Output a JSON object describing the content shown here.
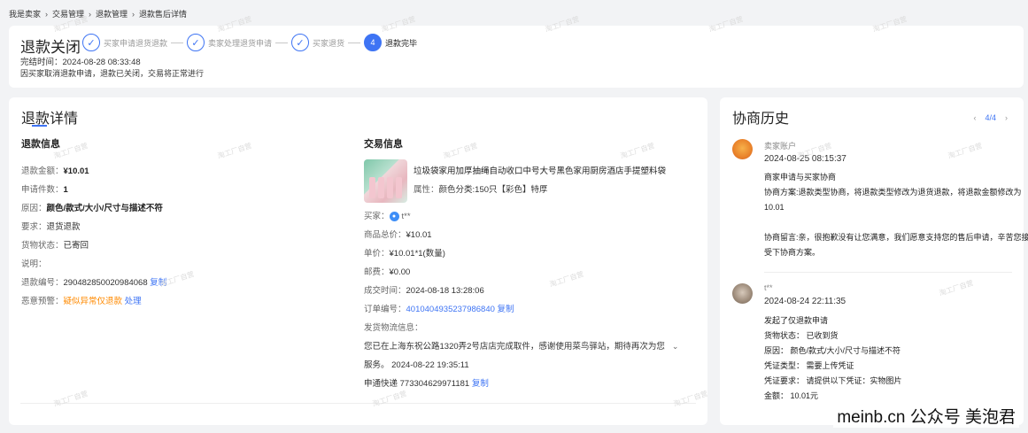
{
  "breadcrumb": [
    "我是卖家",
    "交易管理",
    "退款管理",
    "退款售后详情"
  ],
  "breadcrumb_sep": "›",
  "status": {
    "title": "退款关闭",
    "steps": [
      {
        "label": "买家申请退货退款",
        "icon": "✓"
      },
      {
        "label": "卖家处理退货申请",
        "icon": "✓"
      },
      {
        "label": "买家退货",
        "icon": "✓"
      },
      {
        "label": "退款完毕",
        "icon": "4"
      }
    ],
    "finish_time": "完结时间：2024-08-28 08:33:48",
    "reason": "因买家取消退款申请，退款已关闭，交易将正常进行"
  },
  "detail": {
    "title": "退款详情",
    "refund_info": {
      "heading": "退款信息",
      "amount_label": "退款金额：",
      "amount": "¥10.01",
      "count_label": "申请件数：",
      "count": "1",
      "cause_label": "原因：",
      "cause": "颜色/款式/大小/尺寸与描述不符",
      "request_label": "要求：",
      "request": "退货退款",
      "goods_label": "货物状态：",
      "goods": "已寄回",
      "note_label": "说明：",
      "refund_no_label": "退款编号：",
      "refund_no": "290482850020984068",
      "copy": "复制",
      "alert_label": "恶意预警：",
      "alert": "疑似异常仅退款",
      "handle": "处理"
    },
    "trade_info": {
      "heading": "交易信息",
      "product_name": "垃圾袋家用加厚抽绳自动收口中号大号黑色家用厨房酒店手提塑料袋",
      "attr_label": "属性：",
      "attr": "颜色分类:150只【彩色】特厚",
      "buyer_label": "买家：",
      "buyer": "t**",
      "total_label": "商品总价：",
      "total": "¥10.01",
      "unit_label": "单价：",
      "unit": "¥10.01*1(数量)",
      "postage_label": "邮费：",
      "postage": "¥0.00",
      "deal_time_label": "成交时间：",
      "deal_time": "2024-08-18 13:28:06",
      "order_label": "订单编号：",
      "order_no": "4010404935237986840",
      "copy": "复制",
      "logistics_label": "发货物流信息：",
      "logistics_text": "您已在上海东祝公路1320弄2号店店完成取件，感谢使用菜鸟驿站，期待再次为您",
      "logistics_text2": "服务。 2024-08-22 19:35:11",
      "express": "申通快递 773304629971181",
      "express_copy": "复制"
    }
  },
  "history": {
    "title": "协商历史",
    "page": "4/4",
    "prev": "‹",
    "next": "›",
    "entries": [
      {
        "name": "卖家账户",
        "time": "2024-08-25 08:15:37",
        "lines": [
          "商家申请与买家协商",
          "协商方案:退款类型协商，将退款类型修改为退货退款，将退款金额修改为10.01",
          "",
          "协商留言:亲，很抱歉没有让您满意，我们愿意支持您的售后申请，辛苦您接受下协商方案。"
        ]
      },
      {
        "name": "t**",
        "time": "2024-08-24 22:11:35",
        "lines": [
          "发起了仅退款申请",
          "货物状态： 已收到货",
          "原因： 颜色/款式/大小/尺寸与描述不符",
          "凭证类型： 需要上传凭证",
          "凭证要求： 请提供以下凭证：实物图片",
          "金额： 10.01元"
        ]
      }
    ]
  },
  "watermark_text": "淘工厂自营",
  "brand_mark": "meinb.cn 公众号 美泡君",
  "colors": {
    "accent": "#3e74f4",
    "warning": "#ff8a00"
  }
}
